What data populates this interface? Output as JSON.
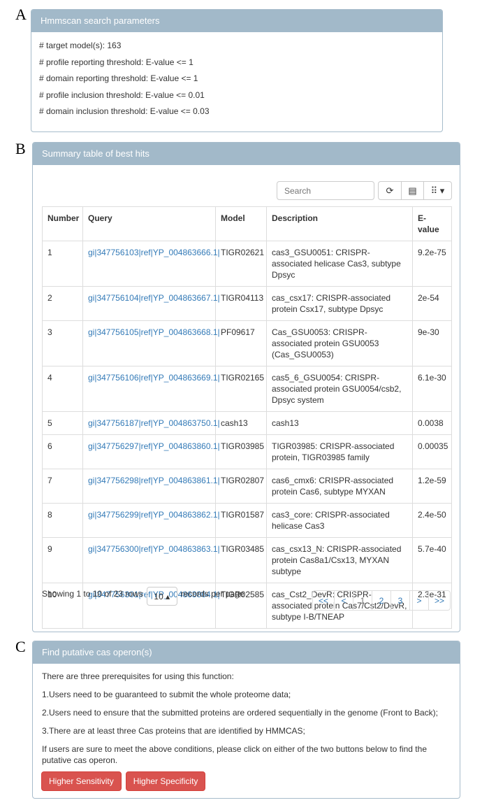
{
  "labels": {
    "a": "A",
    "b": "B",
    "c": "C"
  },
  "params": {
    "title": "Hmmscan search parameters",
    "lines": [
      "# target model(s): 163",
      "# profile reporting threshold: E-value <= 1",
      "# domain reporting threshold: E-value <= 1",
      "# profile inclusion threshold: E-value <= 0.01",
      "# domain inclusion threshold: E-value <= 0.03"
    ]
  },
  "summary": {
    "title": "Summary table of best hits",
    "search_placeholder": "Search",
    "toolbar_icons": [
      "refresh-icon",
      "columns-list-icon",
      "grid-menu-icon"
    ],
    "columns": [
      "Number",
      "Query",
      "Model",
      "Description",
      "E-value"
    ],
    "rows": [
      [
        "1",
        "gi|347756103|ref|YP_004863666.1|",
        "TIGR02621",
        "cas3_GSU0051: CRISPR-associated helicase Cas3, subtype Dpsyc",
        "9.2e-75"
      ],
      [
        "2",
        "gi|347756104|ref|YP_004863667.1|",
        "TIGR04113",
        "cas_csx17: CRISPR-associated protein Csx17, subtype Dpsyc",
        "2e-54"
      ],
      [
        "3",
        "gi|347756105|ref|YP_004863668.1|",
        "PF09617",
        "Cas_GSU0053: CRISPR-associated protein GSU0053 (Cas_GSU0053)",
        "9e-30"
      ],
      [
        "4",
        "gi|347756106|ref|YP_004863669.1|",
        "TIGR02165",
        "cas5_6_GSU0054: CRISPR-associated protein GSU0054/csb2, Dpsyc system",
        "6.1e-30"
      ],
      [
        "5",
        "gi|347756187|ref|YP_004863750.1|",
        "cash13",
        "cash13",
        "0.0038"
      ],
      [
        "6",
        "gi|347756297|ref|YP_004863860.1|",
        "TIGR03985",
        "TIGR03985: CRISPR-associated protein, TIGR03985 family",
        "0.00035"
      ],
      [
        "7",
        "gi|347756298|ref|YP_004863861.1|",
        "TIGR02807",
        "cas6_cmx6: CRISPR-associated protein Cas6, subtype MYXAN",
        "1.2e-59"
      ],
      [
        "8",
        "gi|347756299|ref|YP_004863862.1|",
        "TIGR01587",
        "cas3_core: CRISPR-associated helicase Cas3",
        "2.4e-50"
      ],
      [
        "9",
        "gi|347756300|ref|YP_004863863.1|",
        "TIGR03485",
        "cas_csx13_N: CRISPR-associated protein Cas8a1/Csx13, MYXAN subtype",
        "5.7e-40"
      ],
      [
        "10",
        "gi|347756301|ref|YP_004863864.1|",
        "TIGR02585",
        "cas_Cst2_DevR: CRISPR-associated protein Cas7/Cst2/DevR, subtype I-B/TNEAP",
        "2.3e-31"
      ]
    ],
    "showing": "Showing 1 to 10 of 23 rows",
    "page_size": "10 ▴",
    "per_page": "records per page",
    "pagination": [
      "<<",
      "<",
      "1",
      "2",
      "3",
      ">",
      ">>"
    ],
    "current_page": "1"
  },
  "operon": {
    "title": "Find putative cas operon(s)",
    "lines": [
      "There are three prerequisites for using this function:",
      "1.Users need to be guaranteed to submit the whole proteome data;",
      "2.Users need to ensure that the submitted proteins are ordered sequentially in the genome (Front to Back);",
      "3.There are at least three Cas proteins that are identified by HMMCAS;",
      "If users are sure to meet the above conditions, please click on either of the two buttons below to find the putative cas operon."
    ],
    "buttons": [
      "Higher Sensitivity",
      "Higher Specificity"
    ]
  },
  "colors": {
    "panel_header": "#a2b9c9",
    "link": "#337ab7",
    "danger": "#d9534f"
  }
}
